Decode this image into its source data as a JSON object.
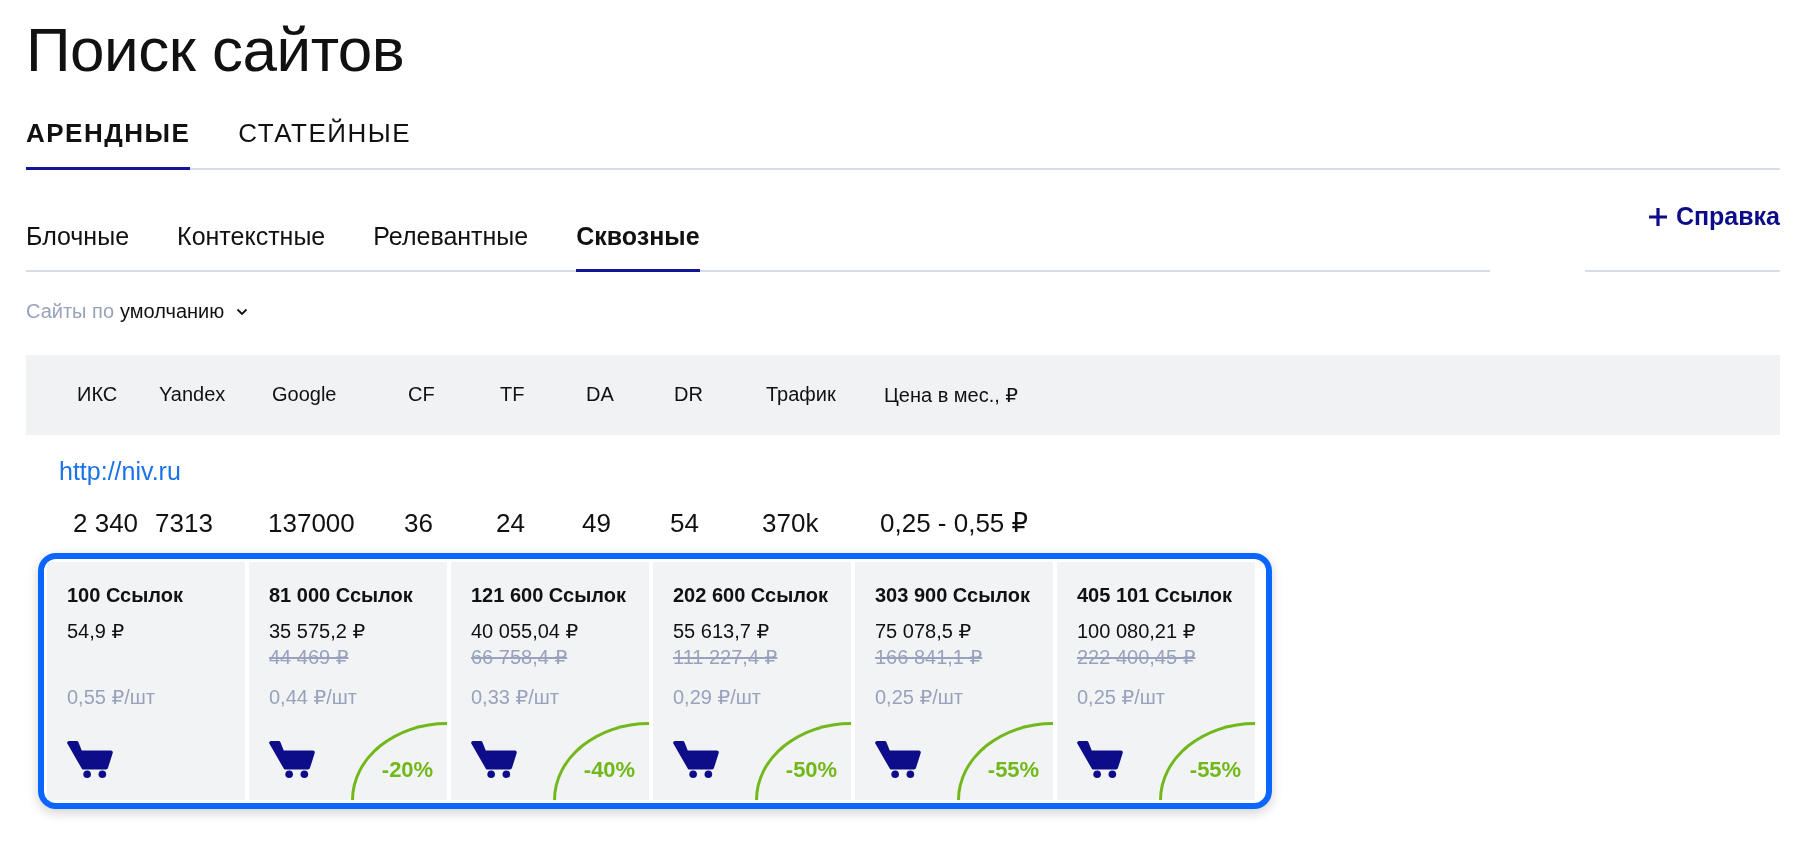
{
  "title": "Поиск сайтов",
  "tabs": [
    {
      "label": "АРЕНДНЫЕ",
      "selected": true
    },
    {
      "label": "СТАТЕЙНЫЕ",
      "selected": false
    }
  ],
  "subtabs": [
    {
      "label": "Блочные",
      "selected": false
    },
    {
      "label": "Контекстные",
      "selected": false
    },
    {
      "label": "Релевантные",
      "selected": false
    },
    {
      "label": "Сквозные",
      "selected": true
    }
  ],
  "help_link": "Справка",
  "sort": {
    "label": "Сайты по",
    "value": "умолчанию"
  },
  "table": {
    "columns": [
      "ИКС",
      "Yandex",
      "Google",
      "CF",
      "TF",
      "DA",
      "DR",
      "Трафик",
      "Цена в мес., ₽"
    ],
    "rows": [
      {
        "url": "http://niv.ru",
        "values": [
          "2 340",
          "7313",
          "137000",
          "36",
          "24",
          "49",
          "54",
          "370k",
          "0,25 - 0,55 ₽"
        ],
        "packages": [
          {
            "links": "100 Ссылок",
            "price": "54,9 ₽",
            "unit_price": "0,55 ₽/шт"
          },
          {
            "links": "81 000 Ссылок",
            "price": "35 575,2 ₽",
            "old_price": "44 469 ₽",
            "unit_price": "0,44 ₽/шт",
            "discount": "-20%"
          },
          {
            "links": "121 600 Ссылок",
            "price": "40 055,04 ₽",
            "old_price": "66 758,4 ₽",
            "unit_price": "0,33 ₽/шт",
            "discount": "-40%"
          },
          {
            "links": "202 600 Ссылок",
            "price": "55 613,7 ₽",
            "old_price": "111 227,4 ₽",
            "unit_price": "0,29 ₽/шт",
            "discount": "-50%"
          },
          {
            "links": "303 900 Ссылок",
            "price": "75 078,5 ₽",
            "old_price": "166 841,1 ₽",
            "unit_price": "0,25 ₽/шт",
            "discount": "-55%"
          },
          {
            "links": "405 101 Ссылок",
            "price": "100 080,21 ₽",
            "old_price": "222 400,45 ₽",
            "unit_price": "0,25 ₽/шт",
            "discount": "-55%"
          }
        ]
      }
    ]
  }
}
